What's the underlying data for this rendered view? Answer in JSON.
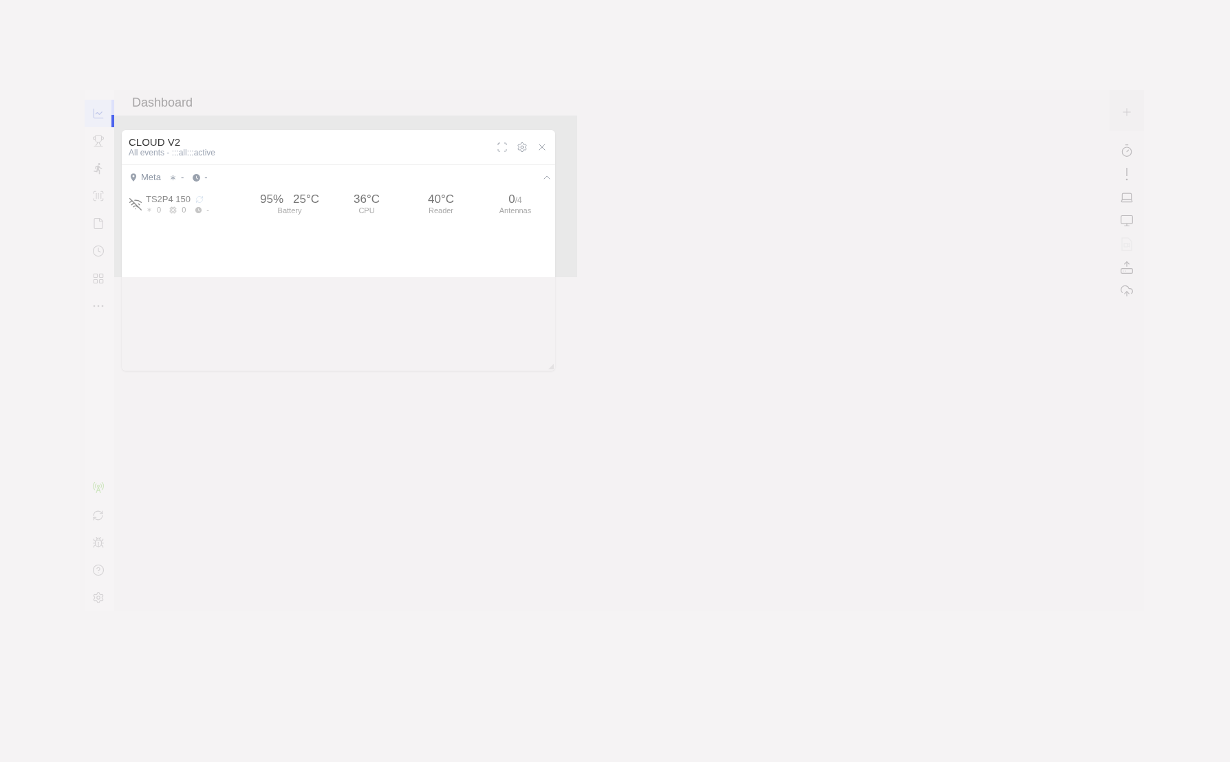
{
  "header": {
    "title": "Dashboard"
  },
  "sidebar": {
    "items": [
      {
        "selected": true
      },
      {
        "selected": false
      },
      {
        "selected": false
      },
      {
        "selected": false
      },
      {
        "selected": false
      },
      {
        "selected": false
      },
      {
        "selected": false
      },
      {
        "selected": false
      }
    ],
    "connection": {
      "color": "#cfe6c0"
    }
  },
  "widget": {
    "title": "CLOUD V2",
    "subtitle": "All events - :::all:::active",
    "filters": {
      "location": "Meta",
      "rate": "-",
      "time": "-",
      "expanded": true
    },
    "devices": [
      {
        "name": "TS2P4 150",
        "online": false,
        "rate": "0",
        "tags": "0",
        "time": "-",
        "metrics": [
          {
            "kind": "pair",
            "values": [
              "95%",
              "25°C"
            ],
            "label": "Battery"
          },
          {
            "kind": "single",
            "value": "36°C",
            "label": "CPU"
          },
          {
            "kind": "single",
            "value": "40°C",
            "label": "Reader"
          },
          {
            "kind": "ratio",
            "value": "0",
            "total": "/4",
            "label": "Antennas"
          }
        ]
      }
    ]
  },
  "right_toolbar": {
    "items": [
      {
        "disabled": false
      },
      {
        "disabled": false
      },
      {
        "disabled": false
      },
      {
        "disabled": false
      },
      {
        "disabled": true
      },
      {
        "disabled": false
      },
      {
        "disabled": false
      }
    ]
  }
}
